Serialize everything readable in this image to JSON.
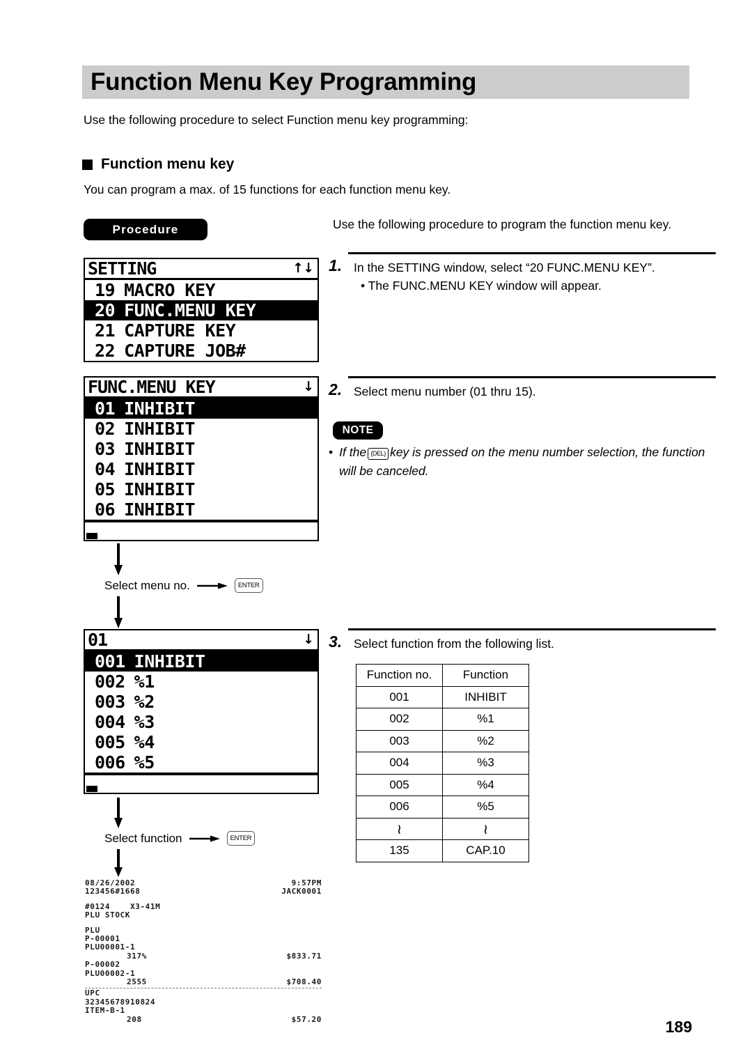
{
  "document": {
    "page_number": "189",
    "title": "Function Menu Key Programming",
    "intro": "Use the following procedure to select Function menu key programming:",
    "section": {
      "heading": "Function menu key",
      "paragraph": "You can program a max. of 15 functions for each function menu key."
    },
    "badges": {
      "procedure": "Procedure",
      "note": "NOTE"
    },
    "procedure_side_text": "Use the following procedure to program the function menu key."
  },
  "lcd_screens": [
    {
      "id": "setting",
      "header": "SETTING",
      "arrows": "↑↓",
      "has_footer": false,
      "rows": [
        {
          "no": "19",
          "label": "MACRO KEY",
          "selected": false
        },
        {
          "no": "20",
          "label": "FUNC.MENU KEY",
          "selected": true
        },
        {
          "no": "21",
          "label": "CAPTURE KEY",
          "selected": false
        },
        {
          "no": "22",
          "label": "CAPTURE JOB#",
          "selected": false
        }
      ]
    },
    {
      "id": "funcmenukey",
      "header": "FUNC.MENU KEY",
      "arrows": "↓",
      "has_footer": true,
      "rows": [
        {
          "no": "01",
          "label": "INHIBIT",
          "selected": true
        },
        {
          "no": "02",
          "label": "INHIBIT",
          "selected": false
        },
        {
          "no": "03",
          "label": "INHIBIT",
          "selected": false
        },
        {
          "no": "04",
          "label": "INHIBIT",
          "selected": false
        },
        {
          "no": "05",
          "label": "INHIBIT",
          "selected": false
        },
        {
          "no": "06",
          "label": "INHIBIT",
          "selected": false
        }
      ]
    },
    {
      "id": "menu01",
      "header": "01",
      "arrows": "↓",
      "has_footer": true,
      "rows": [
        {
          "no": "001",
          "label": "INHIBIT",
          "selected": true
        },
        {
          "no": "002",
          "label": "%1",
          "selected": false
        },
        {
          "no": "003",
          "label": "%2",
          "selected": false
        },
        {
          "no": "004",
          "label": "%3",
          "selected": false
        },
        {
          "no": "005",
          "label": "%4",
          "selected": false
        },
        {
          "no": "006",
          "label": "%5",
          "selected": false
        }
      ]
    }
  ],
  "flow": {
    "select_menu_no_label": "Select menu no.",
    "select_function_label": "Select function",
    "enter_key_label": "ENTER",
    "del_key_label": "(DEL)"
  },
  "steps": [
    {
      "number": "1.",
      "body": "In the SETTING window, select “20 FUNC.MENU KEY”.",
      "sub": "• The FUNC.MENU KEY window will appear."
    },
    {
      "number": "2.",
      "body": "Select menu number (01 thru 15).",
      "sub": ""
    },
    {
      "number": "3.",
      "body": "Select function from the following list.",
      "sub": ""
    }
  ],
  "note": {
    "bullet": "•",
    "text_before_key": "If the",
    "text_after_key": "key is pressed on the menu number selection, the function will be canceled."
  },
  "function_table": {
    "headers": [
      "Function no.",
      "Function"
    ],
    "rows": [
      [
        "001",
        "INHIBIT"
      ],
      [
        "002",
        "%1"
      ],
      [
        "003",
        "%2"
      ],
      [
        "004",
        "%3"
      ],
      [
        "005",
        "%4"
      ],
      [
        "006",
        "%5"
      ],
      [
        "≀",
        "≀"
      ],
      [
        "135",
        "CAP.10"
      ]
    ]
  },
  "receipt": {
    "lines": [
      {
        "type": "pair",
        "left": "08/26/2002",
        "right": "9:57PM"
      },
      {
        "type": "pair",
        "left": "123456#1668",
        "right": "JACK0001"
      },
      {
        "type": "gap"
      },
      {
        "type": "text",
        "left": "#0124    X3-41M"
      },
      {
        "type": "text",
        "left": "PLU STOCK"
      },
      {
        "type": "gap"
      },
      {
        "type": "text",
        "left": "PLU"
      },
      {
        "type": "text",
        "left": "P-00001"
      },
      {
        "type": "text",
        "left": "PLU00001-1"
      },
      {
        "type": "pair-indent",
        "left": "317%",
        "right": "$833.71"
      },
      {
        "type": "text",
        "left": "P-00002"
      },
      {
        "type": "text",
        "left": "PLU00002-1"
      },
      {
        "type": "pair-indent",
        "left": "2555",
        "right": "$708.40"
      },
      {
        "type": "sep"
      },
      {
        "type": "text",
        "left": "UPC"
      },
      {
        "type": "text",
        "left": "32345678910824"
      },
      {
        "type": "text",
        "left": "ITEM-B-1"
      },
      {
        "type": "pair-indent",
        "left": "208",
        "right": "$57.20"
      }
    ]
  },
  "colors": {
    "title_band": "#cccccc",
    "ink": "#000000",
    "paper": "#ffffff"
  }
}
